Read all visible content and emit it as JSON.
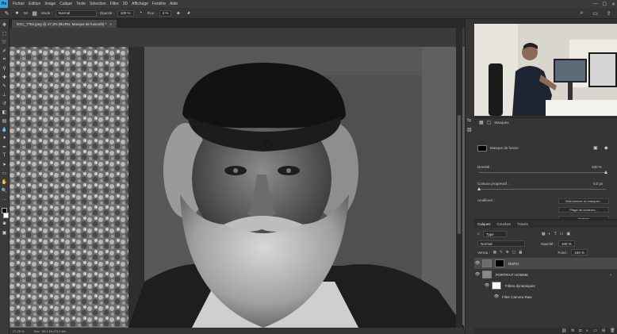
{
  "app": {
    "logo": "Ps",
    "menu": [
      "Fichier",
      "Edition",
      "Image",
      "Calque",
      "Texte",
      "Sélection",
      "Filtre",
      "3D",
      "Affichage",
      "Fenêtre",
      "Aide"
    ],
    "window_controls": [
      "—",
      "☐",
      "✕"
    ]
  },
  "options": {
    "brush_size": "50",
    "mode_label": "Mode :",
    "mode_value": "Normal",
    "opacity_label": "Opacité :",
    "opacity_value": "100 %",
    "flux_label": "Flux :",
    "flux_value": "4 %"
  },
  "document": {
    "tab_title": "DSC_7782.jpeg @ 27,3% (BURN, Masque de fusion/8) *",
    "tab_close": "×"
  },
  "status": {
    "zoom": "27,25 %",
    "doc_info": "Doc : 85,1 Mo/73,3 Mo"
  },
  "properties": {
    "title": "Masques",
    "mask_label": "Masque de fusion",
    "density_label": "Densité :",
    "density_value": "100 %",
    "density_level": 1.0,
    "feather_label": "Contour progressif :",
    "feather_value": "0,0 px",
    "feather_level": 0.0,
    "refine_label": "Améliorer :",
    "btn_select_mask": "Sélectionner et masquer...",
    "btn_color_range": "Plage de couleurs...",
    "btn_invert": "Inverser"
  },
  "layers": {
    "tabs": [
      "Calques",
      "Couches",
      "Tracés"
    ],
    "filter_label": "Type",
    "blend_mode": "Normal",
    "opacity_label": "Opacité :",
    "opacity_value": "100 %",
    "lock_label": "Verrou :",
    "fill_label": "Fond :",
    "fill_value": "100 %",
    "items": [
      {
        "name": "BURN",
        "selected": true
      },
      {
        "name": "PORTRAIT HOMME",
        "selected": false
      },
      {
        "name": "Filtres dynamiques",
        "selected": false
      },
      {
        "name": "Filtre Camera Raw",
        "selected": false
      }
    ]
  },
  "colors": {
    "accent": "#2fa3e6",
    "panel_bg": "#353535",
    "app_bg": "#282828"
  }
}
